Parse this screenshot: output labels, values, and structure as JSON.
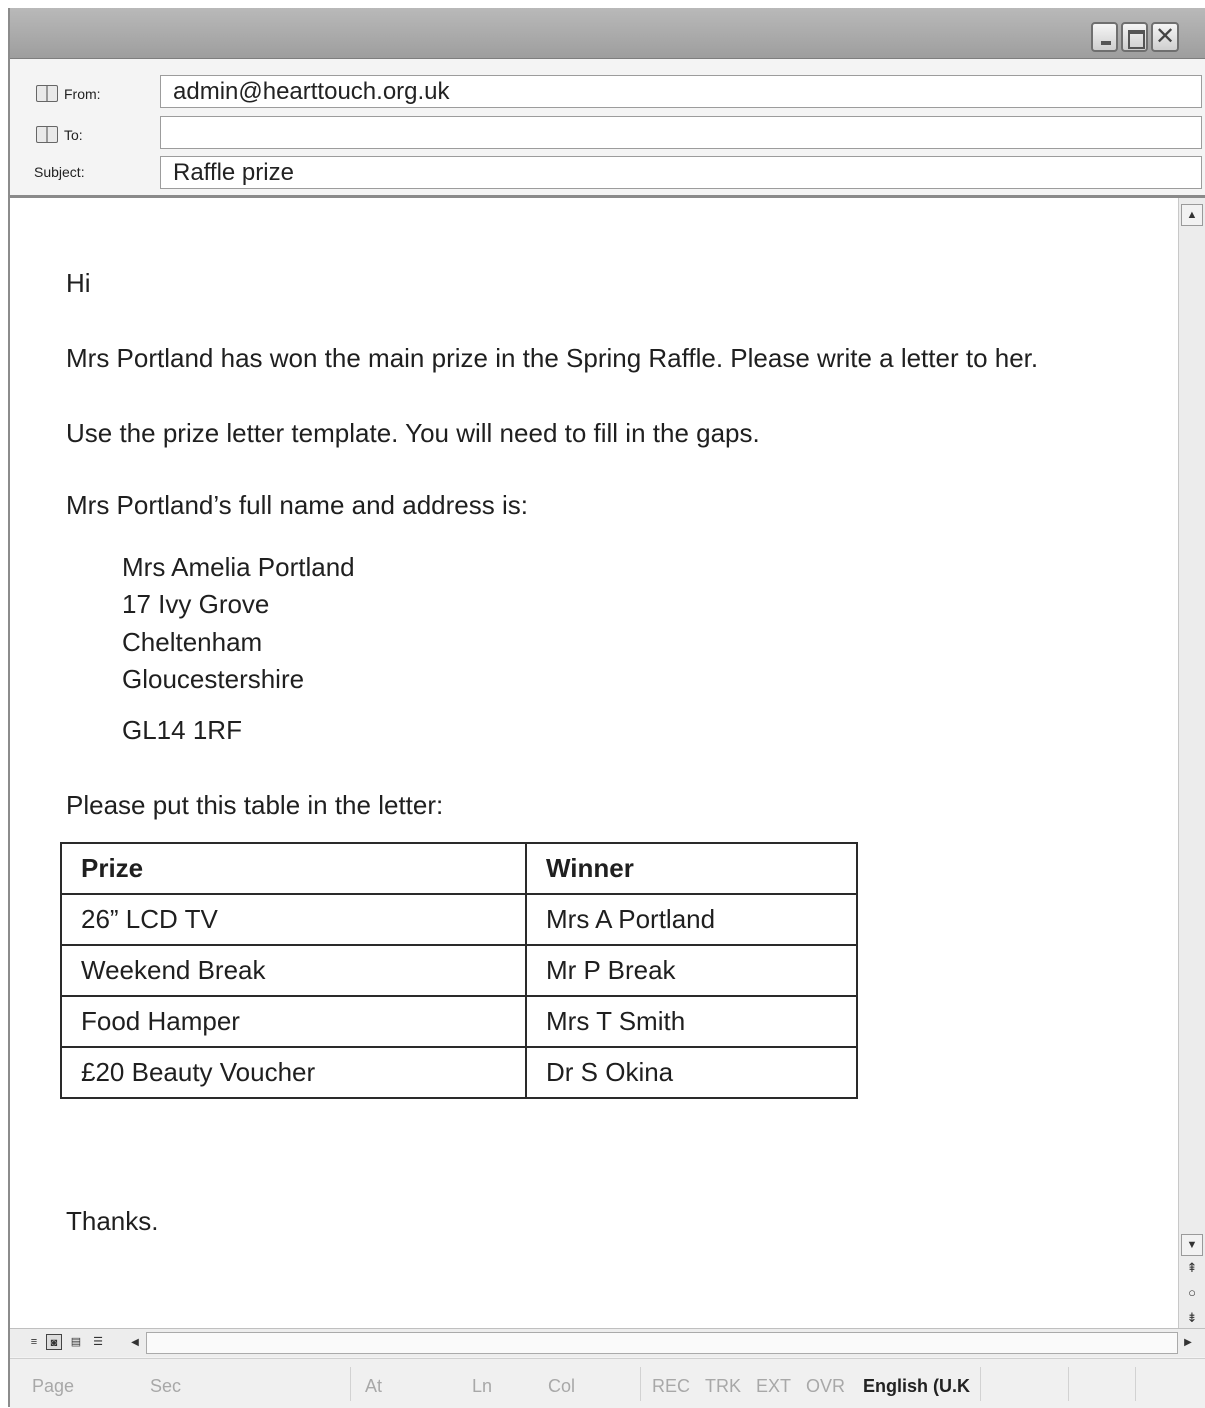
{
  "header": {
    "from_label": "From:",
    "from_value": "admin@hearttouch.org.uk",
    "to_label": "To:",
    "to_value": "",
    "subject_label": "Subject:",
    "subject_value": "Raffle prize"
  },
  "message": {
    "greeting": "Hi",
    "line1": "Mrs Portland has won the main prize in the Spring Raffle. Please write a letter to her.",
    "line2": "Use the prize letter template. You will need to fill in the gaps.",
    "line3": "Mrs Portland’s full name and address is:",
    "address": [
      "Mrs Amelia Portland",
      "17 Ivy Grove",
      "Cheltenham",
      "Gloucestershire",
      "GL14 1RF"
    ],
    "table_intro": "Please put this table in the letter:",
    "table": {
      "headers": [
        "Prize",
        "Winner"
      ],
      "rows": [
        [
          "26” LCD TV",
          "Mrs A Portland"
        ],
        [
          "Weekend Break",
          "Mr P Break"
        ],
        [
          "Food Hamper",
          "Mrs T Smith"
        ],
        [
          "£20 Beauty Voucher",
          "Dr S Okina"
        ]
      ]
    },
    "closing": "Thanks."
  },
  "statusbar": {
    "page": "Page",
    "sec": "Sec",
    "at": "At",
    "ln": "Ln",
    "col": "Col",
    "rec": "REC",
    "trk": "TRK",
    "ext": "EXT",
    "ovr": "OVR",
    "language": "English (U.K"
  },
  "icons": {
    "minimize": "minimize-icon",
    "maximize": "maximize-icon",
    "close": "close-icon",
    "address_book": "address-book-icon"
  }
}
